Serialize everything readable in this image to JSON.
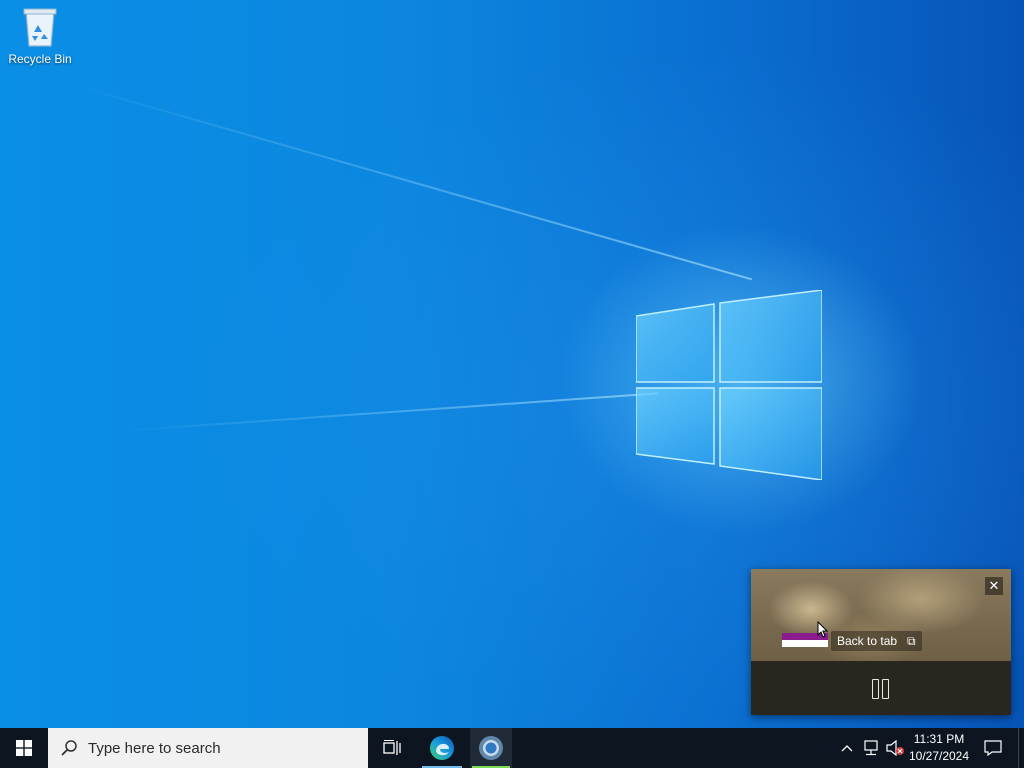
{
  "desktop": {
    "icons": [
      {
        "label": "Recycle Bin",
        "icon": "recycle-bin-icon"
      }
    ]
  },
  "pip_window": {
    "back_to_tab_label": "Back to tab",
    "close_glyph": "✕",
    "state": "playing"
  },
  "taskbar": {
    "search_placeholder": "Type here to search",
    "pinned_apps": [
      {
        "name": "Task View",
        "icon": "task-view-icon"
      },
      {
        "name": "Microsoft Edge",
        "icon": "edge-icon"
      },
      {
        "name": "Google Chrome",
        "icon": "chrome-icon",
        "active": true
      }
    ],
    "tray": {
      "chevron": "^",
      "network_icon": "network-icon",
      "volume_icon": "volume-muted-icon"
    },
    "clock": {
      "time": "11:31 PM",
      "date": "10/27/2024"
    },
    "notification_icon": "action-center-icon"
  },
  "colors": {
    "wallpaper_blue": "#0a86df",
    "taskbar_bg": "#0d1620",
    "search_bg": "#f1f1f1",
    "accent": "#76b9ed"
  }
}
